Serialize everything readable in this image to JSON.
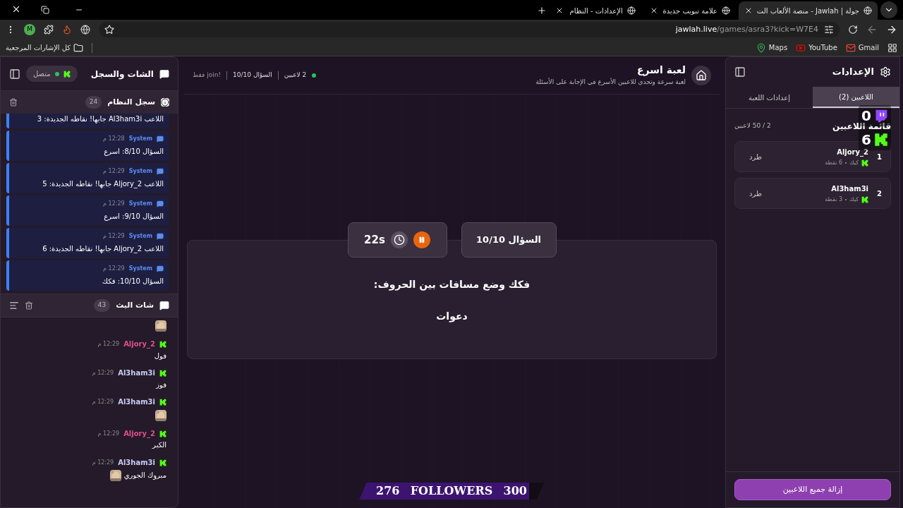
{
  "browser": {
    "tabs": [
      {
        "title": "جولة | Jawlah - منصة الألعاب الت",
        "selected": true
      },
      {
        "title": "علامة تبويب جديدة",
        "selected": false
      },
      {
        "title": "الإعدادات - النظام",
        "selected": false
      }
    ],
    "address": {
      "host": "jawlah.live",
      "path": "/games/asra3?kick=W7E4"
    },
    "profile_initial": "M",
    "bookmarks": [
      {
        "kind": "gmail",
        "label": "Gmail"
      },
      {
        "kind": "youtube",
        "label": "YouTube"
      },
      {
        "kind": "maps",
        "label": "Maps"
      }
    ],
    "all_bookmarks": "كل الإشارات المرجعية"
  },
  "chat_panel": {
    "title": "الشات والسجل",
    "status": "متصل",
    "connected": true,
    "system_log": {
      "title": "سجل النظام",
      "count": "24",
      "entries": [
        {
          "text": "اللاعب Al3ham3i جابها! نقاطه الجديدة: 3"
        },
        {
          "sender": "System",
          "time": "12:28 م",
          "text": "السؤال 8/10: اسرع"
        },
        {
          "sender": "System",
          "time": "12:29 م",
          "text": "اللاعب Aljory_2 جابها! نقاطه الجديدة: 5"
        },
        {
          "sender": "System",
          "time": "12:29 م",
          "text": "السؤال 9/10: اسرع"
        },
        {
          "sender": "System",
          "time": "12:29 م",
          "text": "اللاعب Aljory_2 جابها! نقاطه الجديدة: 6"
        },
        {
          "sender": "System",
          "time": "12:29 م",
          "text": "السؤال 10/10: فكك"
        }
      ]
    },
    "stream_chat": {
      "title": "شات البث",
      "count": "43",
      "messages": [
        {
          "sticker": true
        },
        {
          "user": "Aljory_2",
          "color": "#e0508a",
          "time": "12:29 م",
          "text": "فول"
        },
        {
          "user": "Al3ham3i",
          "color": "#c9cdf5",
          "time": "12:29 م",
          "text": "فوز"
        },
        {
          "user": "Al3ham3i",
          "color": "#c9cdf5",
          "time": "12:29 م",
          "sticker": true
        },
        {
          "user": "Aljory_2",
          "color": "#e0508a",
          "time": "12:29 م",
          "text": "الكبر"
        },
        {
          "user": "Al3ham3i",
          "color": "#c9cdf5",
          "time": "12:29 م",
          "text": "مبروك الجوري",
          "sticker": true
        }
      ]
    }
  },
  "game": {
    "title": "لعبة اسرع",
    "subtitle": "لعبة سرعة وتحدي للاعبين الأسرع في الإجابة على الأسئلة",
    "players_online": "2 لاعبين",
    "question_progress": "السؤال 10/10",
    "join_hint": "!join فقط",
    "question_badge": "السؤال 10/10",
    "timer": "22s",
    "paused": false,
    "prompt": "فكك وضع مسافات بين الحروف:",
    "word": "دعوات"
  },
  "followers_goal": {
    "current": "276",
    "label": "FOLLOWERS",
    "target": "300",
    "level": 0.92
  },
  "overlay_counters": [
    {
      "kind": "twitch",
      "count": "0"
    },
    {
      "kind": "kick",
      "count": "6"
    }
  ],
  "settings": {
    "title": "الإعدادات",
    "tabs": [
      {
        "label": "اللاعبين (2)",
        "selected": true
      },
      {
        "label": "إعدادات اللعبة",
        "selected": false
      }
    ],
    "list_title": "قائمة اللاعبين",
    "capacity": "2 / 50 لاعبين",
    "players": [
      {
        "rank": "1",
        "name": "Aljory_2",
        "platform": "كيك",
        "points": "6 نقطة",
        "kick_label": "طرد"
      },
      {
        "rank": "2",
        "name": "Al3ham3i",
        "platform": "كيك",
        "points": "3 نقطة",
        "kick_label": "طرد"
      }
    ],
    "clear_button": "إزالة جميع اللاعبين"
  }
}
